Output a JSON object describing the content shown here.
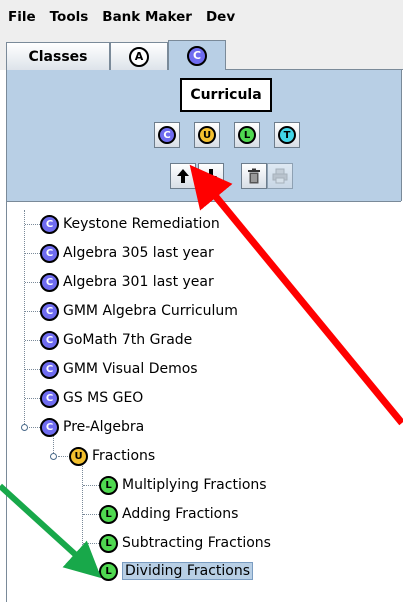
{
  "menubar": {
    "items": [
      "File",
      "Tools",
      "Bank Maker",
      "Dev"
    ]
  },
  "tabs": [
    {
      "label": "Classes",
      "badge": ""
    },
    {
      "label": "",
      "badge": "A"
    },
    {
      "label": "",
      "badge": "C"
    }
  ],
  "toolbar": {
    "title": "Curricula",
    "badges": [
      "C",
      "U",
      "L",
      "T"
    ]
  },
  "tree": {
    "nodes": [
      {
        "badge": "C",
        "label": "Keystone Remediation"
      },
      {
        "badge": "C",
        "label": "Algebra 305 last year"
      },
      {
        "badge": "C",
        "label": "Algebra 301 last year"
      },
      {
        "badge": "C",
        "label": "GMM Algebra Curriculum"
      },
      {
        "badge": "C",
        "label": "GoMath 7th Grade"
      },
      {
        "badge": "C",
        "label": "GMM Visual Demos"
      },
      {
        "badge": "C",
        "label": "GS MS GEO"
      },
      {
        "badge": "C",
        "label": "Pre-Algebra"
      },
      {
        "badge": "U",
        "label": "Fractions"
      },
      {
        "badge": "L",
        "label": "Multiplying Fractions"
      },
      {
        "badge": "L",
        "label": "Adding Fractions"
      },
      {
        "badge": "L",
        "label": "Subtracting Fractions"
      },
      {
        "badge": "L",
        "label": "Dividing Fractions"
      }
    ]
  },
  "colors": {
    "curriculum": "#6f6cf0",
    "unit": "#f3c02e",
    "lesson": "#4fd850",
    "topic": "#42d6e8",
    "panel": "#b8cfe5",
    "annotation_red": "#ff0000",
    "annotation_green": "#18a84a"
  }
}
